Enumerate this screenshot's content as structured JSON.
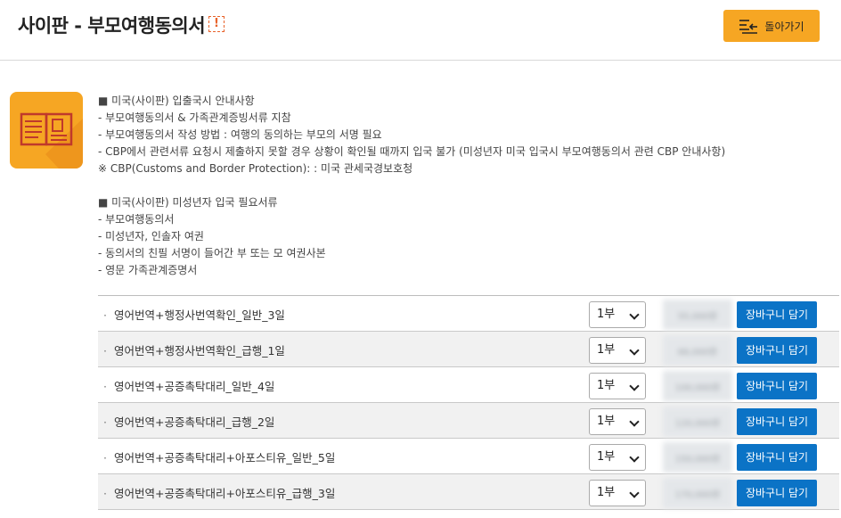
{
  "header": {
    "title": "사이판 - 부모여행동의서",
    "alert_symbol": "!",
    "back_button": "돌아가기"
  },
  "info": {
    "section1": [
      "■ 미국(사이판) 입출국시 안내사항",
      "- 부모여행동의서 & 가족관계증빙서류 지참",
      "- 부모여행동의서 작성 방법 : 여행의 동의하는 부모의 서명 필요",
      "- CBP에서 관련서류 요청시 제출하지 못할 경우 상황이 확인될 때까지 입국 불가 (미성년자 미국 입국시 부모여행동의서 관련 CBP 안내사항)",
      "※ CBP(Customs and Border Protection): : 미국 관세국경보호청"
    ],
    "section2": [
      "■ 미국(사이판) 미성년자 입국 필요서류",
      "- 부모여행동의서",
      "- 미성년자, 인솔자 여권",
      "- 동의서의 친필 서명이 들어간 부 또는 모 여권사본",
      "- 영문 가족관계증명서"
    ]
  },
  "products": [
    {
      "name": "영어번역+행정사번역확인_일반_3일",
      "qty": "1부",
      "price": "55,000원",
      "button": "장바구니 담기"
    },
    {
      "name": "영어번역+행정사번역확인_급행_1일",
      "qty": "1부",
      "price": "66,000원",
      "button": "장바구니 담기"
    },
    {
      "name": "영어번역+공증촉탁대리_일반_4일",
      "qty": "1부",
      "price": "100,000원",
      "button": "장바구니 담기"
    },
    {
      "name": "영어번역+공증촉탁대리_급행_2일",
      "qty": "1부",
      "price": "120,000원",
      "button": "장바구니 담기"
    },
    {
      "name": "영어번역+공증촉탁대리+아포스티유_일반_5일",
      "qty": "1부",
      "price": "150,000원",
      "button": "장바구니 담기"
    },
    {
      "name": "영어번역+공증촉탁대리+아포스티유_급행_3일",
      "qty": "1부",
      "price": "170,000원",
      "button": "장바구니 담기"
    }
  ],
  "colors": {
    "accent": "#f6a623",
    "button": "#0b73c6",
    "alert": "#e8632b"
  },
  "icons": {
    "back": "list-back-icon",
    "document": "document-icon",
    "alert": "alert-icon"
  }
}
